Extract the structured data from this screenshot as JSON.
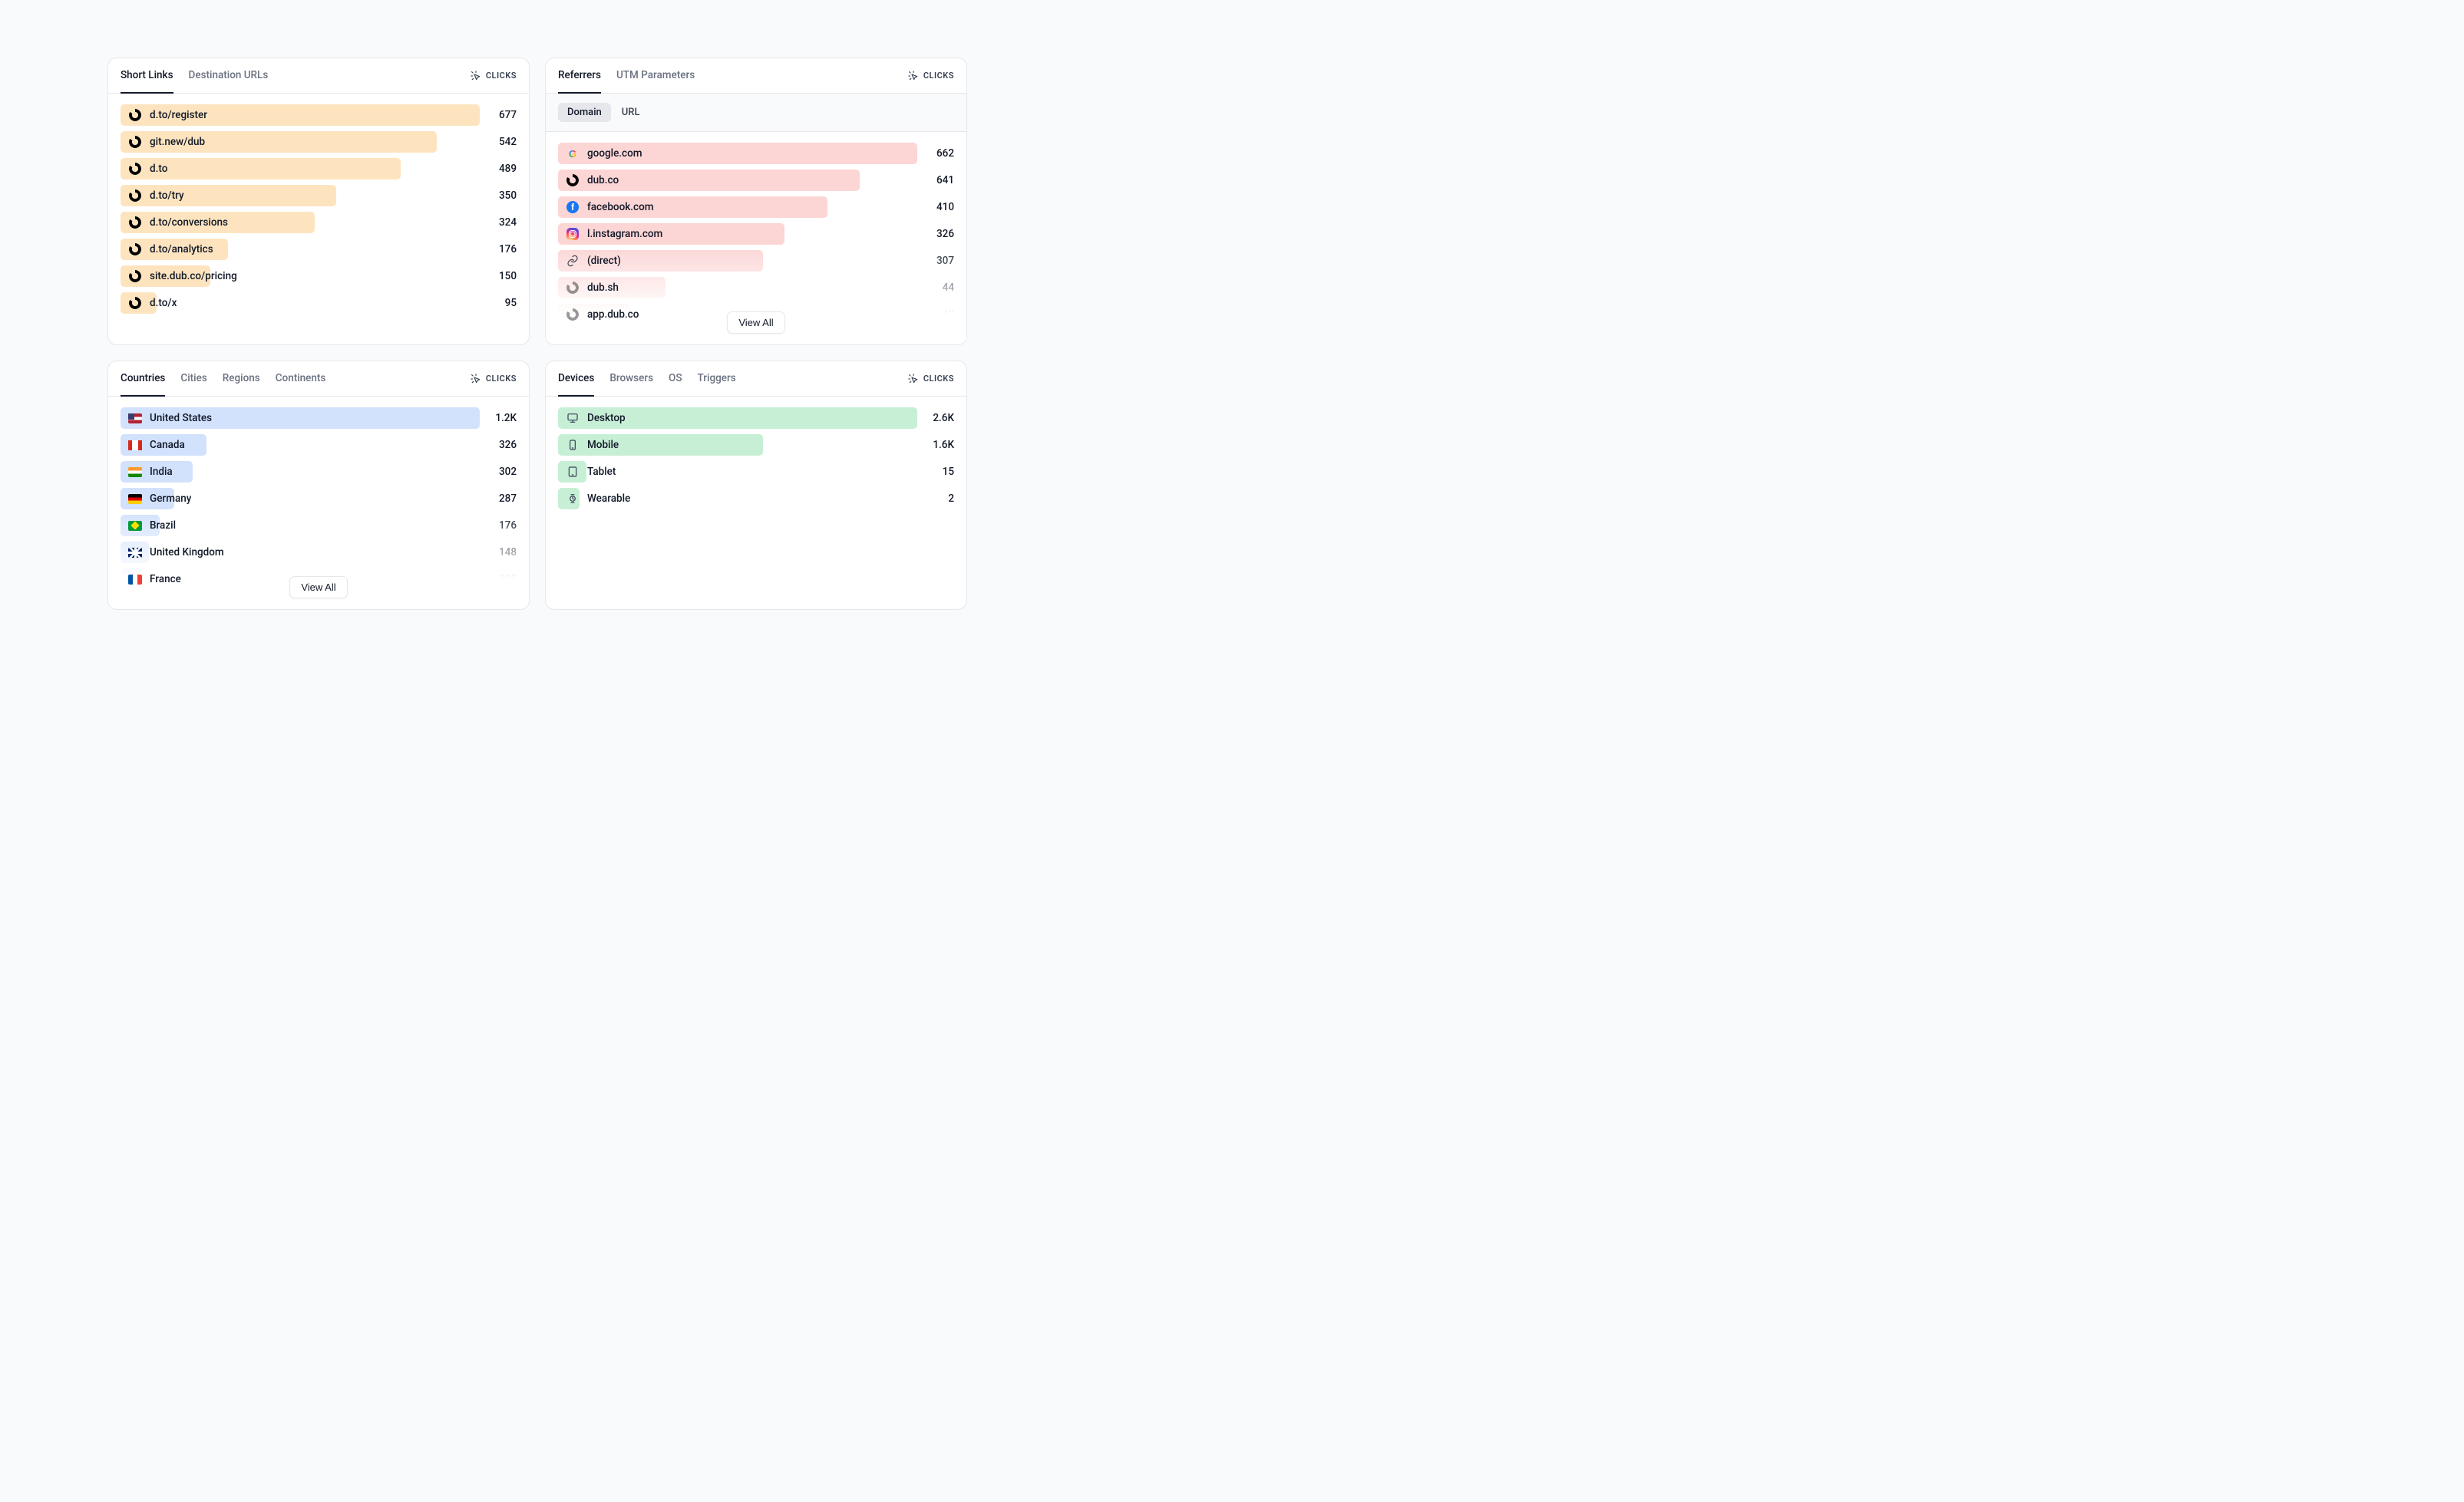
{
  "headerLabel": "CLICKS",
  "viewAll": "View All",
  "cards": {
    "links": {
      "tabs": [
        "Short Links",
        "Destination URLs"
      ],
      "activeTab": 0,
      "barColor": "orange",
      "rows": [
        {
          "icon": "dub",
          "label": "d.to/register",
          "value": "677",
          "pct": 100
        },
        {
          "icon": "dub",
          "label": "git.new/dub",
          "value": "542",
          "pct": 88
        },
        {
          "icon": "dub",
          "label": "d.to",
          "value": "489",
          "pct": 78
        },
        {
          "icon": "dub",
          "label": "d.to/try",
          "value": "350",
          "pct": 60
        },
        {
          "icon": "dub",
          "label": "d.to/conversions",
          "value": "324",
          "pct": 54
        },
        {
          "icon": "dub",
          "label": "d.to/analytics",
          "value": "176",
          "pct": 30
        },
        {
          "icon": "dub",
          "label": "site.dub.co/pricing",
          "value": "150",
          "pct": 25
        },
        {
          "icon": "dub",
          "label": "d.to/x",
          "value": "95",
          "pct": 10
        }
      ]
    },
    "referrers": {
      "tabs": [
        "Referrers",
        "UTM Parameters"
      ],
      "activeTab": 0,
      "subtabs": [
        "Domain",
        "URL"
      ],
      "activeSubtab": 0,
      "barColor": "pink",
      "showViewAll": true,
      "rows": [
        {
          "icon": "google",
          "label": "google.com",
          "value": "662",
          "pct": 100
        },
        {
          "icon": "dub",
          "label": "dub.co",
          "value": "641",
          "pct": 84
        },
        {
          "icon": "facebook",
          "label": "facebook.com",
          "value": "410",
          "pct": 75
        },
        {
          "icon": "instagram",
          "label": "l.instagram.com",
          "value": "326",
          "pct": 63
        },
        {
          "icon": "link",
          "label": "(direct)",
          "value": "307",
          "pct": 57
        },
        {
          "icon": "dub-gray",
          "label": "dub.sh",
          "value": "44",
          "pct": 30
        },
        {
          "icon": "dub-gray",
          "label": "app.dub.co",
          "value": "42",
          "pct": 20
        }
      ]
    },
    "countries": {
      "tabs": [
        "Countries",
        "Cities",
        "Regions",
        "Continents"
      ],
      "activeTab": 0,
      "barColor": "blue",
      "showViewAll": true,
      "rows": [
        {
          "icon": "flag-us",
          "label": "United States",
          "value": "1.2K",
          "pct": 100
        },
        {
          "icon": "flag-ca",
          "label": "Canada",
          "value": "326",
          "pct": 24
        },
        {
          "icon": "flag-in",
          "label": "India",
          "value": "302",
          "pct": 20
        },
        {
          "icon": "flag-de",
          "label": "Germany",
          "value": "287",
          "pct": 15
        },
        {
          "icon": "flag-br",
          "label": "Brazil",
          "value": "176",
          "pct": 11
        },
        {
          "icon": "flag-gb",
          "label": "United Kingdom",
          "value": "148",
          "pct": 8
        },
        {
          "icon": "flag-fr",
          "label": "France",
          "value": "125",
          "pct": 6
        }
      ]
    },
    "devices": {
      "tabs": [
        "Devices",
        "Browsers",
        "OS",
        "Triggers"
      ],
      "activeTab": 0,
      "barColor": "green",
      "rows": [
        {
          "icon": "monitor",
          "label": "Desktop",
          "value": "2.6K",
          "pct": 100
        },
        {
          "icon": "mobile",
          "label": "Mobile",
          "value": "1.6K",
          "pct": 57
        },
        {
          "icon": "tablet",
          "label": "Tablet",
          "value": "15",
          "pct": 8
        },
        {
          "icon": "watch",
          "label": "Wearable",
          "value": "2",
          "pct": 6
        }
      ]
    }
  }
}
